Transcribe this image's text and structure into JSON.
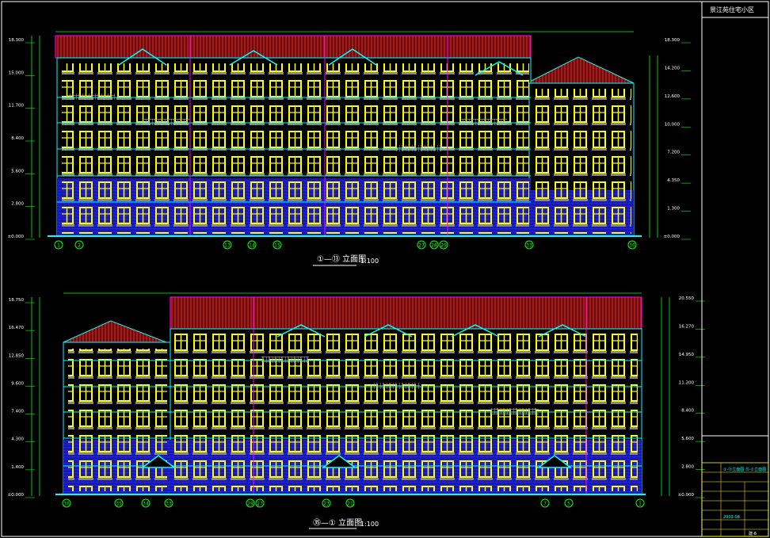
{
  "title_block": {
    "project_name": "景江苑住宅小区",
    "drawing_title": "①-⑬立面图 ㉟-①立面图",
    "sheet_no": "建-6",
    "date": "2003-08"
  },
  "elevation_top": {
    "caption": "①—⑬ 立面图",
    "scale": "1:100",
    "axis_labels": [
      "1",
      "2",
      "13",
      "14",
      "15",
      "27",
      "28",
      "29",
      "33",
      "36"
    ],
    "levels_left": [
      "18.300",
      "15.000",
      "11.700",
      "8.400",
      "5.600",
      "2.800",
      "±0.000"
    ],
    "levels_right": [
      "18.300",
      "14.200",
      "12.600",
      "10.000",
      "7.200",
      "4.350",
      "1.300",
      "±0.000"
    ]
  },
  "elevation_bottom": {
    "caption": "㉟—① 立面图",
    "scale": "1:100",
    "axis_labels": [
      "36",
      "35",
      "34",
      "33",
      "29",
      "27",
      "23",
      "21",
      "7",
      "5",
      "1"
    ],
    "levels_left": [
      "18.750",
      "16.470",
      "12.850",
      "9.600",
      "7.400",
      "4.300",
      "1.400",
      "±0.000"
    ],
    "levels_right": [
      "20.550",
      "16.270",
      "14.950",
      "11.200",
      "8.400",
      "5.600",
      "2.800",
      "±0.000"
    ]
  },
  "colors": {
    "background": "#000000",
    "roof": "#a01818",
    "wall_blue": "#2020c8",
    "window_yellow": "#ffff00",
    "outline_cyan": "#00ffff",
    "dim_green": "#00ff00",
    "frame_white": "#ffffff",
    "magenta": "#ff00ff"
  }
}
